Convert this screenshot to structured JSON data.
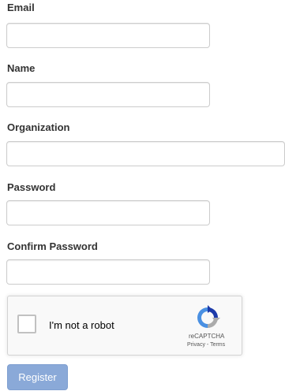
{
  "form": {
    "fields": [
      {
        "label": "Email",
        "value": ""
      },
      {
        "label": "Name",
        "value": ""
      },
      {
        "label": "Organization",
        "value": ""
      },
      {
        "label": "Password",
        "value": ""
      },
      {
        "label": "Confirm Password",
        "value": ""
      }
    ],
    "register_label": "Register"
  },
  "captcha": {
    "checkbox_label": "I'm not a robot",
    "brand": "reCAPTCHA",
    "privacy_link": "Privacy",
    "separator": " - ",
    "terms_link": "Terms",
    "logo_icon": "recaptcha-icon"
  },
  "colors": {
    "register_button": "#8aa9d8",
    "recaptcha_blue": "#1c3aa9",
    "recaptcha_light": "#4a90e2",
    "recaptcha_gray": "#ababab"
  }
}
